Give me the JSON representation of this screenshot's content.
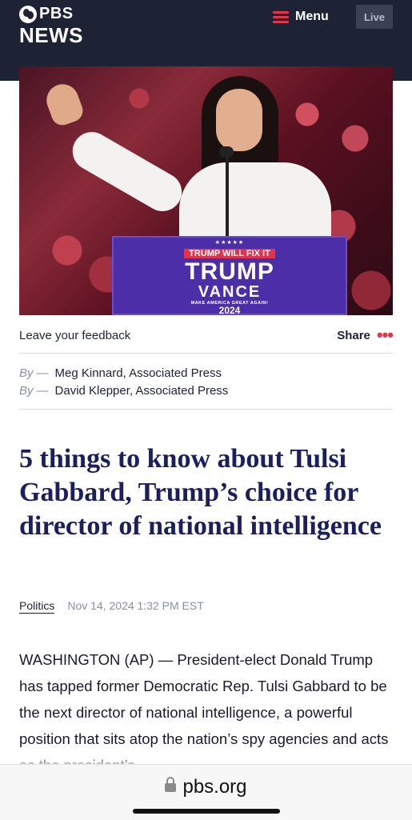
{
  "header": {
    "logo_brand": "PBS",
    "logo_section": "NEWS",
    "menu_label": "Menu",
    "live_label": "Live"
  },
  "photo": {
    "podium_slogan_left": "TRUMP WILL",
    "podium_slogan_right": "FIX IT",
    "podium_name1": "TRUMP",
    "podium_name2": "VANCE",
    "podium_tagline": "MAKE AMERICA GREAT AGAIN!",
    "podium_year": "2024"
  },
  "feedback": {
    "feedback_label": "Leave your feedback",
    "share_label": "Share",
    "more_icon": "•••"
  },
  "bylines": [
    {
      "by": "By",
      "author": "Meg Kinnard, Associated Press"
    },
    {
      "by": "By",
      "author": "David Klepper, Associated Press"
    }
  ],
  "article": {
    "headline": "5 things to know about Tulsi Gabbard, Trump’s choice for director of national intelligence",
    "category": "Politics",
    "date": "Nov 14, 2024 1:32 PM EST",
    "body": "WASHINGTON (AP) — President-elect Donald Trump has tapped former Democratic Rep. Tulsi Gabbard to be the next director of national intelligence, a powerful position that sits atop the nation’s spy agencies and acts as the president’s"
  },
  "browser": {
    "url": "pbs.org"
  },
  "colors": {
    "header_bg": "#1e2235",
    "accent_red": "#e8344a",
    "headline_navy": "#1b1f5e"
  }
}
